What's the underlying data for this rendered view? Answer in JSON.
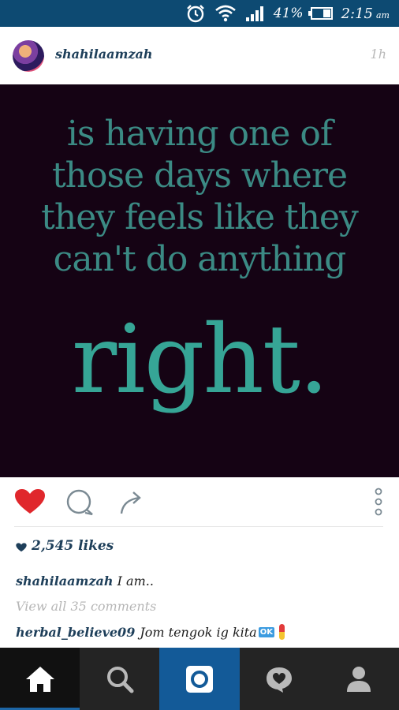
{
  "status_bar": {
    "battery_percent": "41%",
    "time": "2:15",
    "ampm": "am",
    "icons": [
      "alarm-icon",
      "wifi-icon",
      "signal-icon",
      "battery-icon"
    ]
  },
  "post": {
    "username": "shahilaamzah",
    "time_ago": "1h",
    "image_text": {
      "lines": [
        "is having one of",
        "those days where",
        "they feels like they",
        "can't do anything"
      ],
      "emphasis": "right."
    },
    "likes": "2,545 likes",
    "caption": {
      "user": "shahilaamzah",
      "text": "I am.."
    },
    "view_all_comments": "View all 35 comments",
    "comments": [
      {
        "user": "herbal_believe09",
        "text": "Jom tengok ig kita",
        "badge": "OK"
      }
    ]
  },
  "colors": {
    "status_bar": "#0d4a72",
    "like_red": "#e0272c",
    "username_blue": "#1e3f5a",
    "nav_bg": "#242424",
    "nav_active": "#135a98",
    "quote_teal": "#3b8a84"
  },
  "bottom_nav": [
    "home-icon",
    "search-icon",
    "camera-icon",
    "activity-icon",
    "profile-icon"
  ]
}
